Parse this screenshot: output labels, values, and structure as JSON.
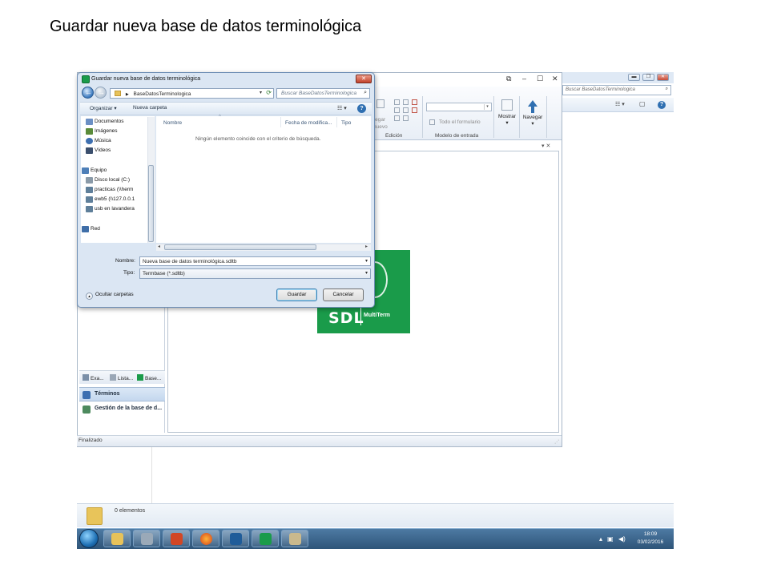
{
  "slide": {
    "title": "Guardar nueva base de datos terminológica"
  },
  "explorer": {
    "search_placeholder": "Buscar BaseDatosTerminologica",
    "status_count": "0 elementos"
  },
  "taskbar": {
    "time": "18:09",
    "date": "03/02/2016"
  },
  "multiterm": {
    "ribbon": {
      "add_label": "regar",
      "add_label2": "nuevo",
      "edicion_label": "Edición",
      "form_label": "Todo el formulario",
      "input_model_label": "Modelo de entrada",
      "show_label": "Mostrar",
      "navigate_label": "Navegar"
    },
    "nav_tabs": [
      "Exa...",
      "Lista...",
      "Base..."
    ],
    "nav_buttons": [
      "Términos",
      "Gestión de la base de d..."
    ],
    "status": "Finalizado",
    "logo": {
      "brand": "SDL",
      "product": "MultiTerm",
      "color": "#1a9b4a"
    }
  },
  "dialog": {
    "title": "Guardar nueva base de datos terminológica",
    "address": "BaseDatosTerminologica",
    "search_placeholder": "Buscar BaseDatosTerminologica",
    "toolbar": {
      "organize": "Organizar ▾",
      "new_folder": "Nueva carpeta"
    },
    "tree": [
      {
        "label": "Documentos",
        "icon": "documents-icon",
        "color": "#6b8fc4"
      },
      {
        "label": "Imágenes",
        "icon": "pictures-icon",
        "color": "#5a8b3a"
      },
      {
        "label": "Música",
        "icon": "music-icon",
        "color": "#3d6fb0"
      },
      {
        "label": "Vídeos",
        "icon": "videos-icon",
        "color": "#3b4f6d"
      },
      {
        "label": "Equipo",
        "icon": "computer-icon",
        "color": "#4e7fb8"
      },
      {
        "label": "Disco local (C:)",
        "icon": "drive-icon",
        "color": "#8a9aa8"
      },
      {
        "label": "practicas (\\\\herm",
        "icon": "network-drive-icon",
        "color": "#5f7f9a"
      },
      {
        "label": "ewb5 (\\\\127.0.0.1",
        "icon": "network-drive-icon",
        "color": "#5f7f9a"
      },
      {
        "label": "usb en lavandera",
        "icon": "network-drive-icon",
        "color": "#5f7f9a"
      },
      {
        "label": "Red",
        "icon": "network-icon",
        "color": "#3f6ea8"
      }
    ],
    "columns": [
      "Nombre",
      "Fecha de modifica...",
      "Tipo"
    ],
    "empty_message": "Ningún elemento coincide con el criterio de búsqueda.",
    "name_label": "Nombre:",
    "name_value": "Nueva base de datos terminológica.sdltb",
    "type_label": "Tipo:",
    "type_value": "Termbase (*.sdltb)",
    "hide_folders": "Ocultar carpetas",
    "save_button": "Guardar",
    "cancel_button": "Cancelar"
  }
}
